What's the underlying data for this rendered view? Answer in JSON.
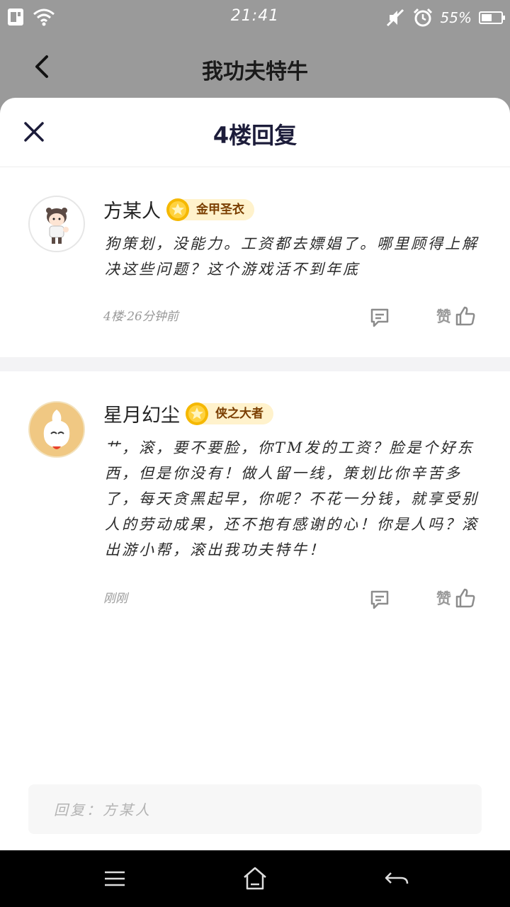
{
  "status_bar": {
    "time": "21:41",
    "battery": "55%",
    "battery_level": 0.55
  },
  "app_bar": {
    "title": "我功夫特牛"
  },
  "sheet": {
    "title": "4楼回复"
  },
  "posts": [
    {
      "username": "方某人",
      "badge": "金甲圣衣",
      "content": "狗策划，没能力。工资都去嫖娼了。哪里顾得上解决这些问题？这个游戏活不到年底",
      "meta": "4楼·26分钟前",
      "like_label": "赞"
    },
    {
      "username": "星月幻尘",
      "badge": "侠之大者",
      "content": "艹，滚，要不要脸，你TM发的工资？脸是个好东西，但是你没有！做人留一线，策划比你辛苦多了，每天贪黑起早，你呢？不花一分钱，就享受别人的劳动成果，还不抱有感谢的心！你是人吗？滚出游小帮，滚出我功夫特牛！",
      "meta": "刚刚",
      "like_label": "赞"
    }
  ],
  "reply_input": {
    "placeholder": "回复：方某人"
  },
  "colors": {
    "overlay_gray": "#9a9a9a",
    "badge_bg": "#fff2cc",
    "medal_gold": "#f5b800",
    "title_navy": "#1c1c3a"
  },
  "icons": [
    "wifi-icon",
    "sim-icon",
    "mute-icon",
    "alarm-icon",
    "battery-icon",
    "back-arrow-icon",
    "close-icon",
    "medal-icon",
    "comment-icon",
    "thumbs-up-icon",
    "menu-icon",
    "home-icon",
    "return-icon"
  ]
}
